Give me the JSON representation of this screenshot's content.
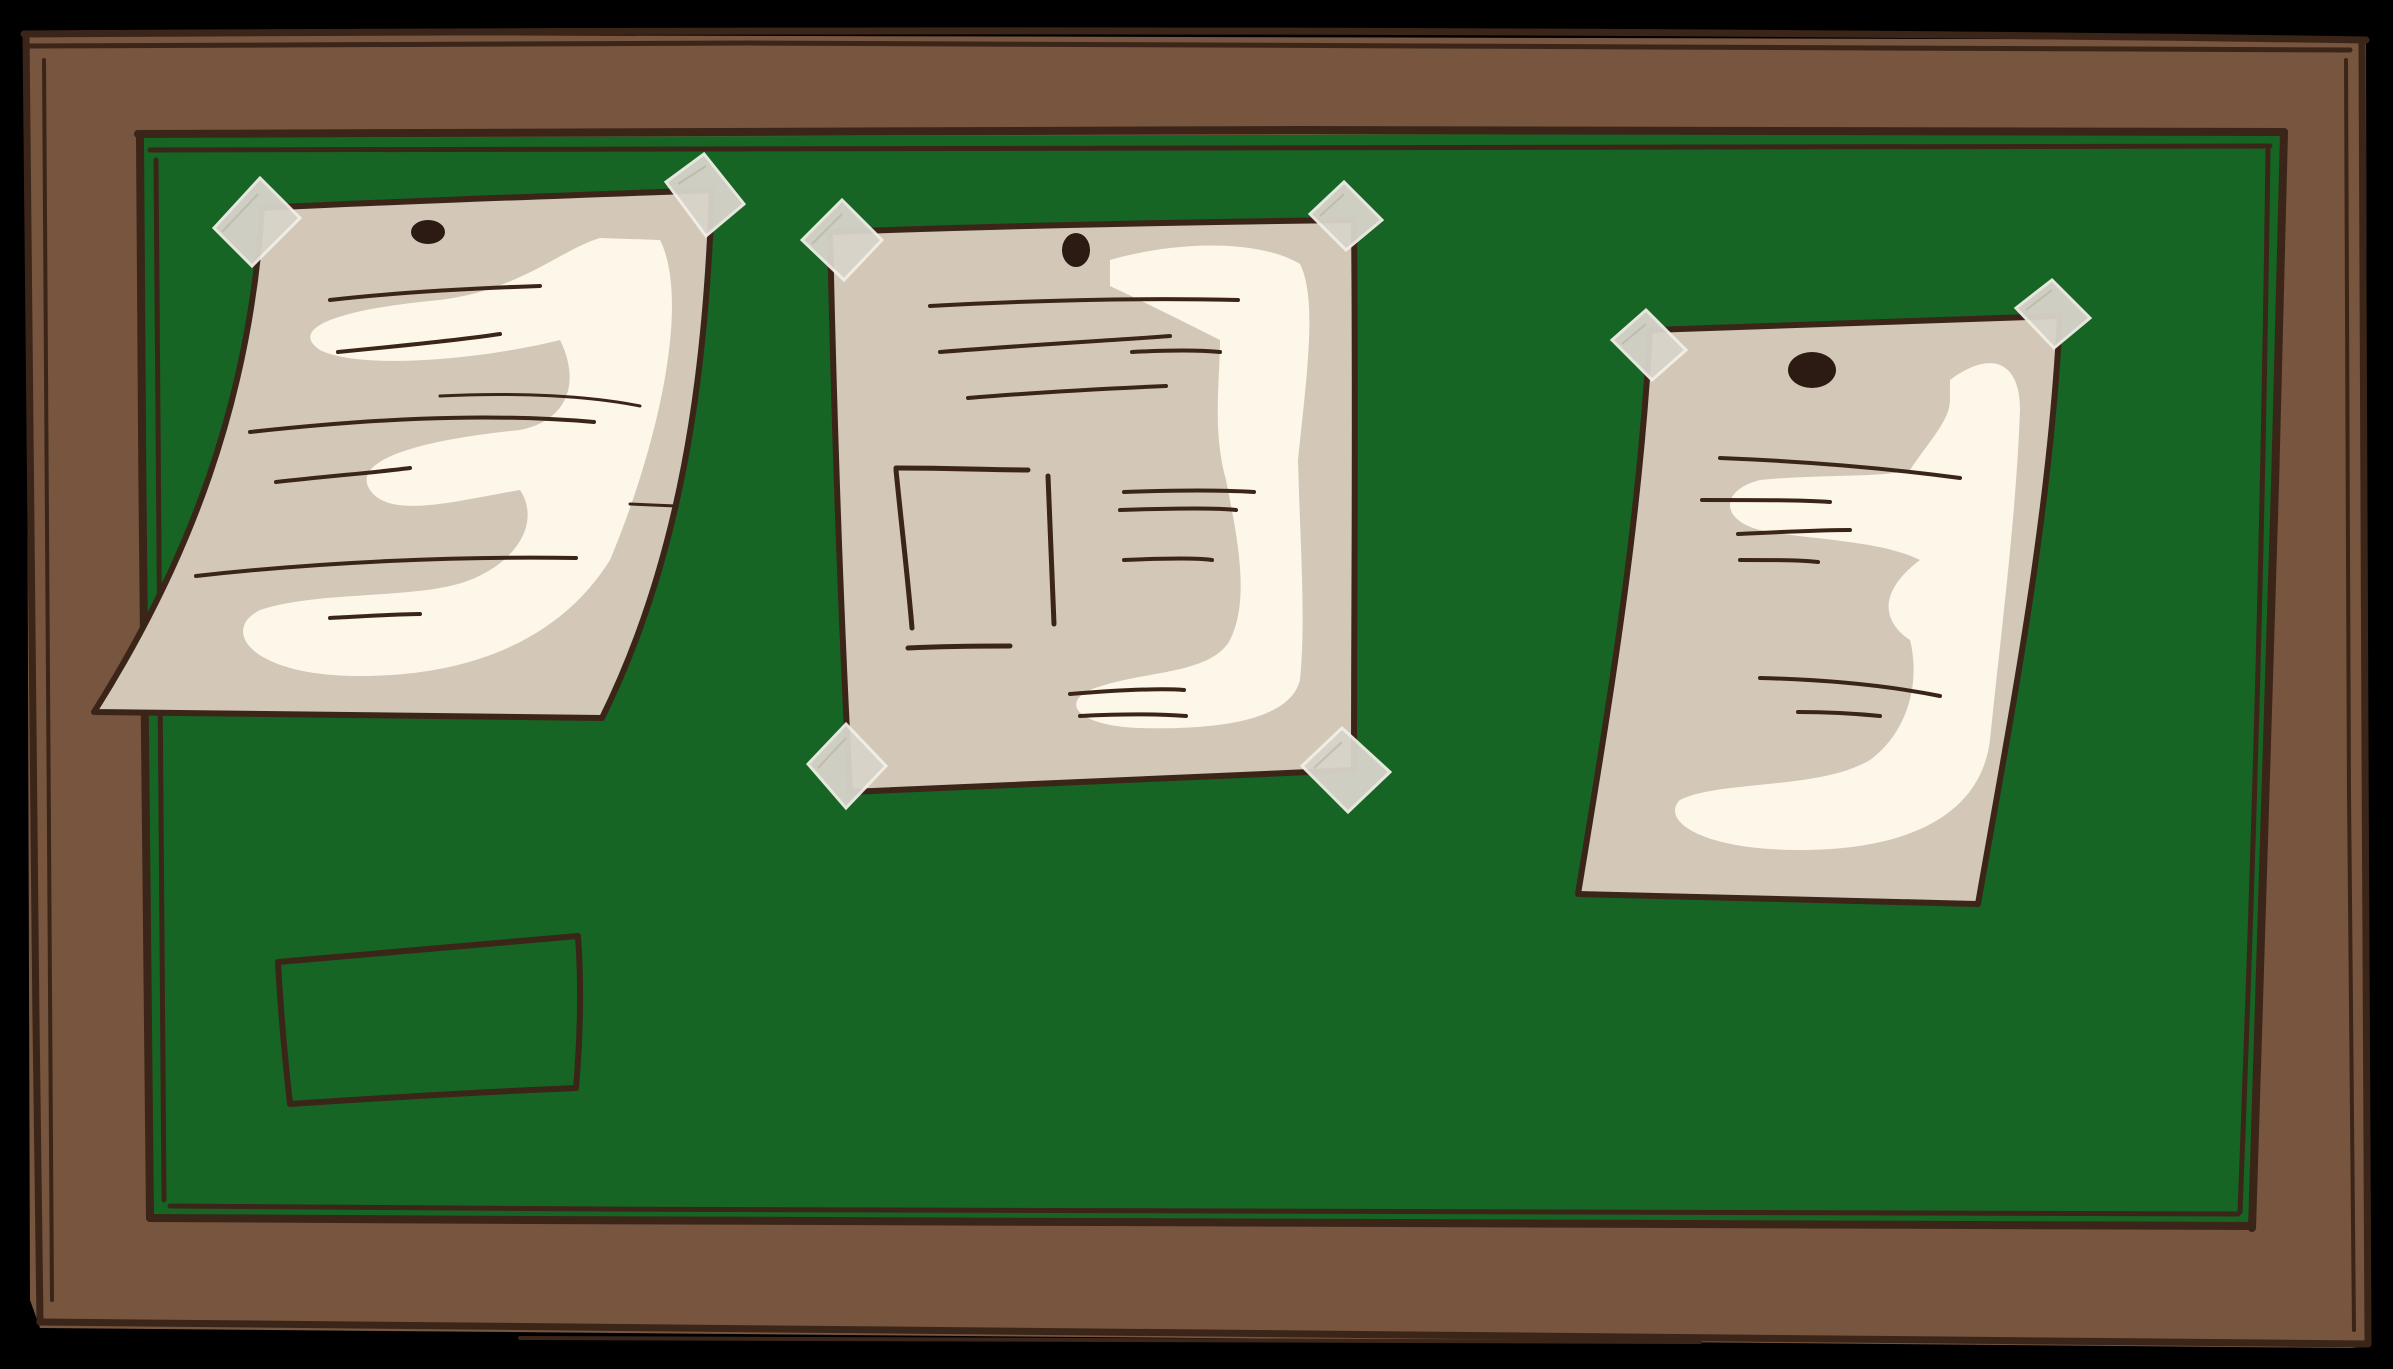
{
  "scene": {
    "subject": "bulletin-board",
    "colors": {
      "background": "#000000",
      "frame": "#77553f",
      "frame_outline": "#3b2518",
      "board": "#176524",
      "paper": "#d3c8b7",
      "paper_highlight": "#fdf7ea",
      "tape": "#d8d4cb",
      "ink": "#3b2518"
    },
    "notices": [
      {
        "id": "curled-notice",
        "fastening": "tape-top-corners-and-pin"
      },
      {
        "id": "layout-notice",
        "fastening": "tape-four-corners-and-pin"
      },
      {
        "id": "tilted-notice",
        "fastening": "tape-top-corners-and-pin"
      }
    ],
    "empty_label_box": {
      "text": ""
    }
  }
}
